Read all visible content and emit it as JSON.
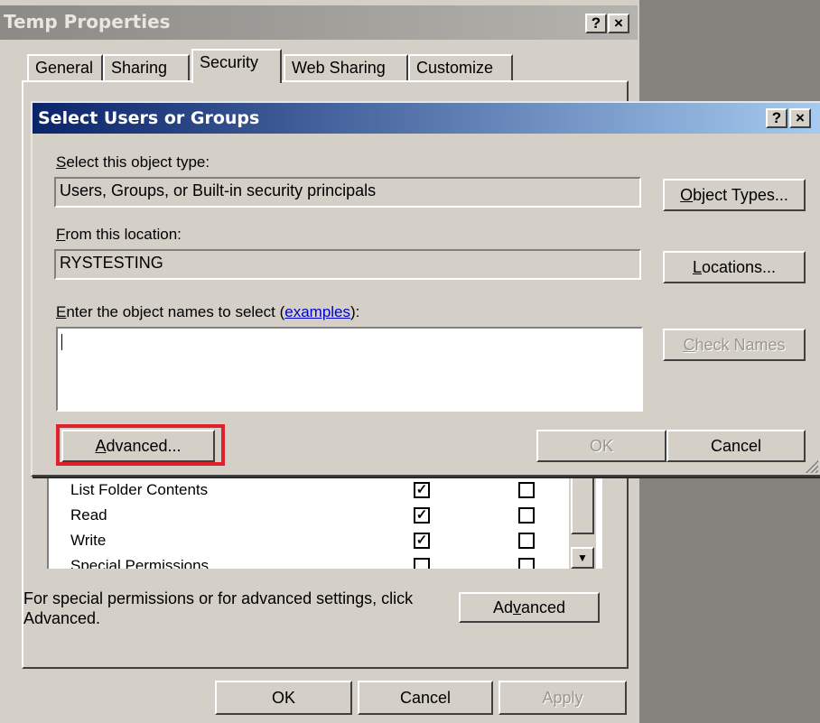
{
  "properties_window": {
    "title": "Temp Properties",
    "help_btn": "?",
    "close_btn": "×",
    "tabs": [
      {
        "label": "General"
      },
      {
        "label": "Sharing"
      },
      {
        "label": "Security"
      },
      {
        "label": "Web Sharing"
      },
      {
        "label": "Customize"
      }
    ],
    "permissions": [
      {
        "label": "List Folder Contents",
        "allow": true,
        "deny": false
      },
      {
        "label": "Read",
        "allow": true,
        "deny": false
      },
      {
        "label": "Write",
        "allow": true,
        "deny": false
      },
      {
        "label": "Special Permissions",
        "allow": false,
        "deny": false
      }
    ],
    "special_text": "For special permissions or for advanced settings, click Advanced.",
    "advanced_pre": "Ad",
    "advanced_u": "v",
    "advanced_post": "anced",
    "ok": "OK",
    "cancel": "Cancel",
    "apply": "Apply"
  },
  "dialog": {
    "title": "Select Users or Groups",
    "help_btn": "?",
    "close_btn": "×",
    "object_type_label_u": "S",
    "object_type_label_rest": "elect this object type:",
    "object_type_value": "Users, Groups, or Built-in security principals",
    "object_types_btn_u": "O",
    "object_types_btn_rest": "bject Types...",
    "location_label_u": "F",
    "location_label_rest": "rom this location:",
    "location_value": "RYSTESTING",
    "locations_btn_u": "L",
    "locations_btn_rest": "ocations...",
    "names_label_u": "E",
    "names_label_rest": "nter the object names to select (",
    "names_link": "examples",
    "names_label_end": "):",
    "check_names_btn_u": "C",
    "check_names_btn_rest": "heck Names",
    "advanced_btn_u": "A",
    "advanced_btn_rest": "dvanced...",
    "ok_btn": "OK",
    "cancel_btn": "Cancel"
  }
}
